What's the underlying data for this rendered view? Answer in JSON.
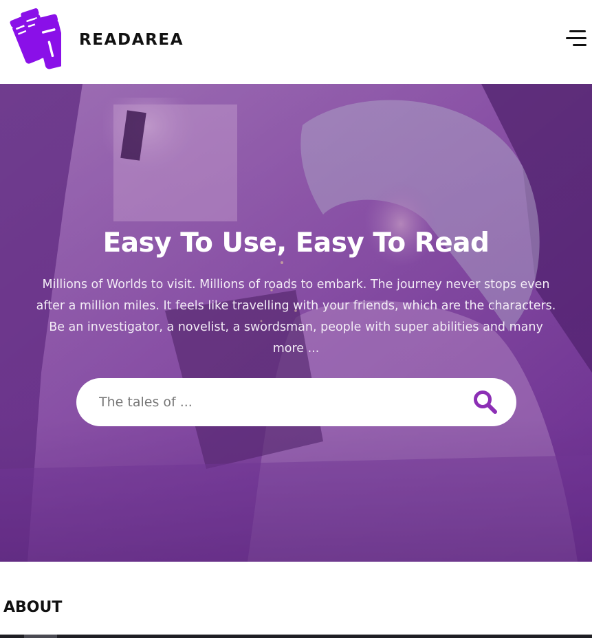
{
  "header": {
    "logo_icon": "books-icon",
    "brand_name": "READAREA",
    "menu_icon": "hamburger-menu-icon"
  },
  "hero": {
    "title": "Easy To Use, Easy To Read",
    "description": "Millions of Worlds to visit. Millions of roads to embark. The journey never stops even after a million miles. It feels like travelling with your friends, which are the characters. Be an investigator, a novelist, a swordsman, people with super abilities and many more ...",
    "search": {
      "placeholder": "The tales of ...",
      "value": "",
      "icon": "search-icon"
    }
  },
  "about": {
    "heading": "ABOUT"
  },
  "colors": {
    "brand_purple": "#8a10e8",
    "search_icon_purple": "#8c2fb5",
    "hero_overlay": "#7a3e9e"
  }
}
